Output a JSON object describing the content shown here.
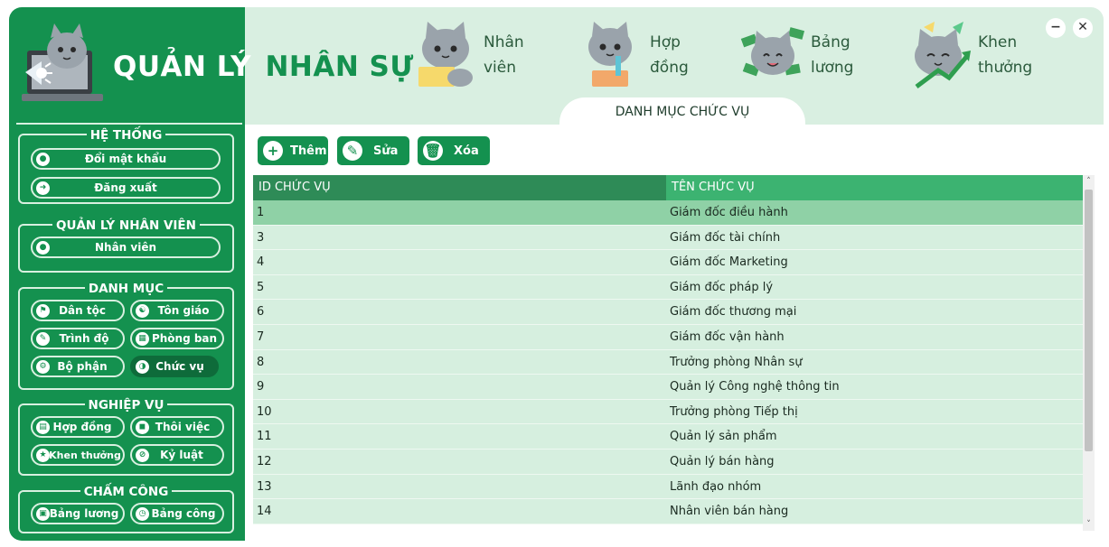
{
  "app": {
    "title_part1": "QUẢN LÝ",
    "title_part2": "NHÂN SỰ"
  },
  "sidebar": {
    "groups": {
      "system": {
        "title": "HỆ THỐNG",
        "change_password": "Đổi mật khẩu",
        "logout": "Đăng xuất"
      },
      "employee": {
        "title": "QUẢN LÝ NHÂN VIÊN",
        "employees": "Nhân viên"
      },
      "catalog": {
        "title": "DANH MỤC",
        "ethnicity": "Dân tộc",
        "religion": "Tôn giáo",
        "education": "Trình độ",
        "department": "Phòng ban",
        "division": "Bộ phận",
        "position": "Chức vụ"
      },
      "business": {
        "title": "NGHIỆP VỤ",
        "contract": "Hợp đồng",
        "resignation": "Thôi việc",
        "reward": "Khen thưởng",
        "discipline": "Kỷ luật"
      },
      "timekeeping": {
        "title": "CHẤM CÔNG",
        "payroll": "Bảng lương",
        "attendance": "Bảng công"
      }
    }
  },
  "header": {
    "nav": [
      {
        "l1": "Nhân",
        "l2": "viên"
      },
      {
        "l1": "Hợp",
        "l2": "đồng"
      },
      {
        "l1": "Bảng",
        "l2": "lương"
      },
      {
        "l1": "Khen",
        "l2": "thưởng"
      }
    ],
    "minimize": "−",
    "close": "✕",
    "section_tab": "DANH MỤC CHỨC VỤ"
  },
  "toolbar": {
    "add": "Thêm",
    "edit": "Sửa",
    "delete": "Xóa"
  },
  "table": {
    "headers": [
      "ID CHỨC VỤ",
      "TÊN CHỨC VỤ"
    ],
    "rows": [
      [
        "1",
        "Giám đốc điều hành"
      ],
      [
        "3",
        "Giám đốc tài chính"
      ],
      [
        "4",
        "Giám đốc Marketing"
      ],
      [
        "5",
        "Giám đốc pháp lý"
      ],
      [
        "6",
        "Giám đốc thương mại"
      ],
      [
        "7",
        "Giám đốc vận hành"
      ],
      [
        "8",
        "Trưởng phòng Nhân sự"
      ],
      [
        "9",
        "Quản lý Công nghệ thông tin"
      ],
      [
        "10",
        "Trưởng phòng Tiếp thị"
      ],
      [
        "11",
        "Quản lý sản phẩm"
      ],
      [
        "12",
        "Quản lý bán hàng"
      ],
      [
        "13",
        "Lãnh đạo nhóm"
      ],
      [
        "14",
        "Nhân viên bán hàng"
      ]
    ],
    "selected_row": 0
  },
  "colors": {
    "sidebar_bg": "#14914f",
    "header_bg": "#d9efe1",
    "row_bg": "#d6efdf",
    "row_selected": "#8fd1a6",
    "header_col1": "#2e8b57",
    "header_col2": "#3cb371"
  },
  "icons": {
    "logo": "cat-laptop-megaphone",
    "nav": [
      "cat-laptop-icon",
      "cat-contract-icon",
      "cat-money-icon",
      "cat-trophy-icon"
    ]
  }
}
